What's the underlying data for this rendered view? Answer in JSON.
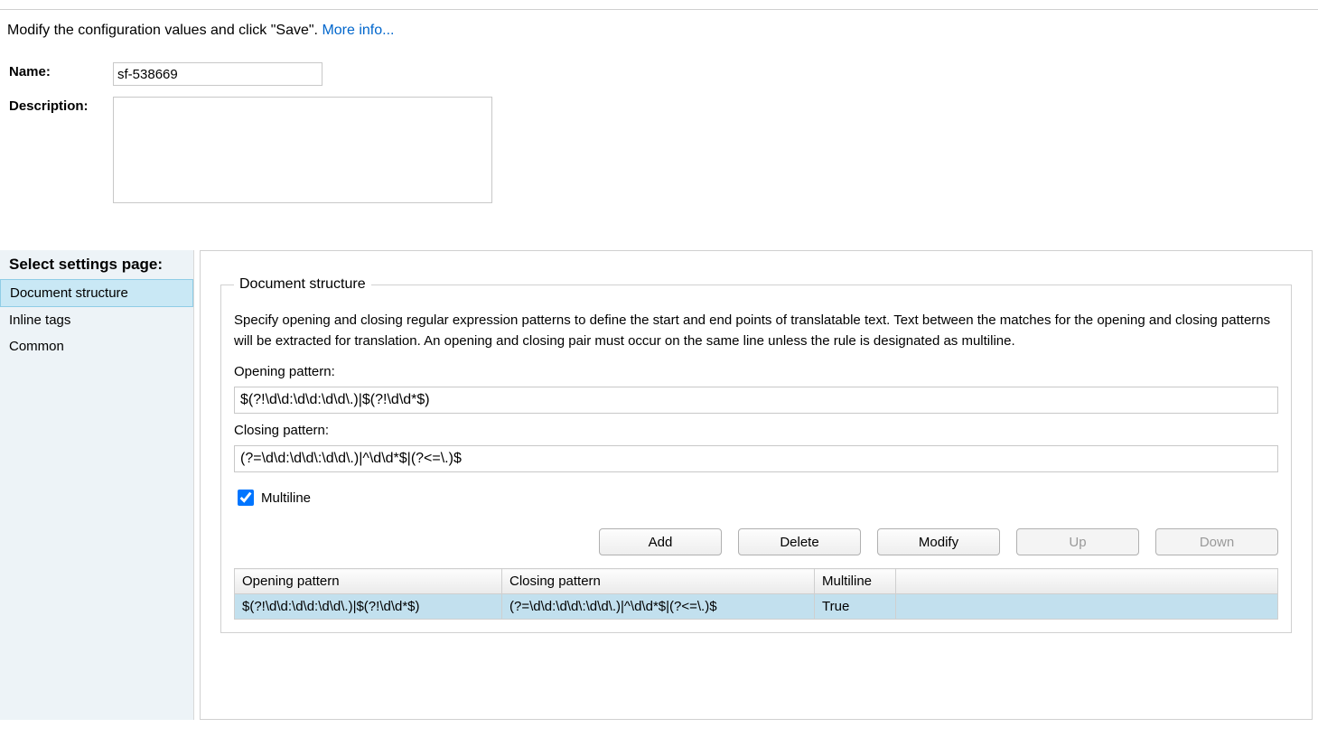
{
  "instruction": {
    "text": "Modify the configuration values and click \"Save\". ",
    "link": "More info..."
  },
  "form": {
    "name_label": "Name:",
    "name_value": "sf-538669",
    "description_label": "Description:",
    "description_value": ""
  },
  "sidebar": {
    "title": "Select settings page:",
    "items": [
      {
        "label": "Document structure",
        "selected": true
      },
      {
        "label": "Inline tags",
        "selected": false
      },
      {
        "label": "Common",
        "selected": false
      }
    ]
  },
  "panel": {
    "legend": "Document structure",
    "description": "Specify opening and closing regular expression patterns to define the start and end points of translatable text. Text between the matches for the opening and closing patterns will be extracted for translation. An opening and closing pair must occur on the same line unless the rule is designated as multiline.",
    "opening_label": "Opening pattern:",
    "opening_value": "$(?!\\d\\d:\\d\\d:\\d\\d\\.)|$(?!\\d\\d*$)",
    "closing_label": "Closing pattern:",
    "closing_value": "(?=\\d\\d:\\d\\d\\:\\d\\d\\.)|^\\d\\d*$|(?<=\\.)$",
    "multiline_label": "Multiline",
    "multiline_checked": true,
    "buttons": {
      "add": "Add",
      "delete": "Delete",
      "modify": "Modify",
      "up": "Up",
      "down": "Down"
    },
    "table": {
      "headers": {
        "opening": "Opening pattern",
        "closing": "Closing pattern",
        "multiline": "Multiline"
      },
      "rows": [
        {
          "opening": "$(?!\\d\\d:\\d\\d:\\d\\d\\.)|$(?!\\d\\d*$)",
          "closing": "(?=\\d\\d:\\d\\d\\:\\d\\d\\.)|^\\d\\d*$|(?<=\\.)$",
          "multiline": "True"
        }
      ]
    }
  }
}
